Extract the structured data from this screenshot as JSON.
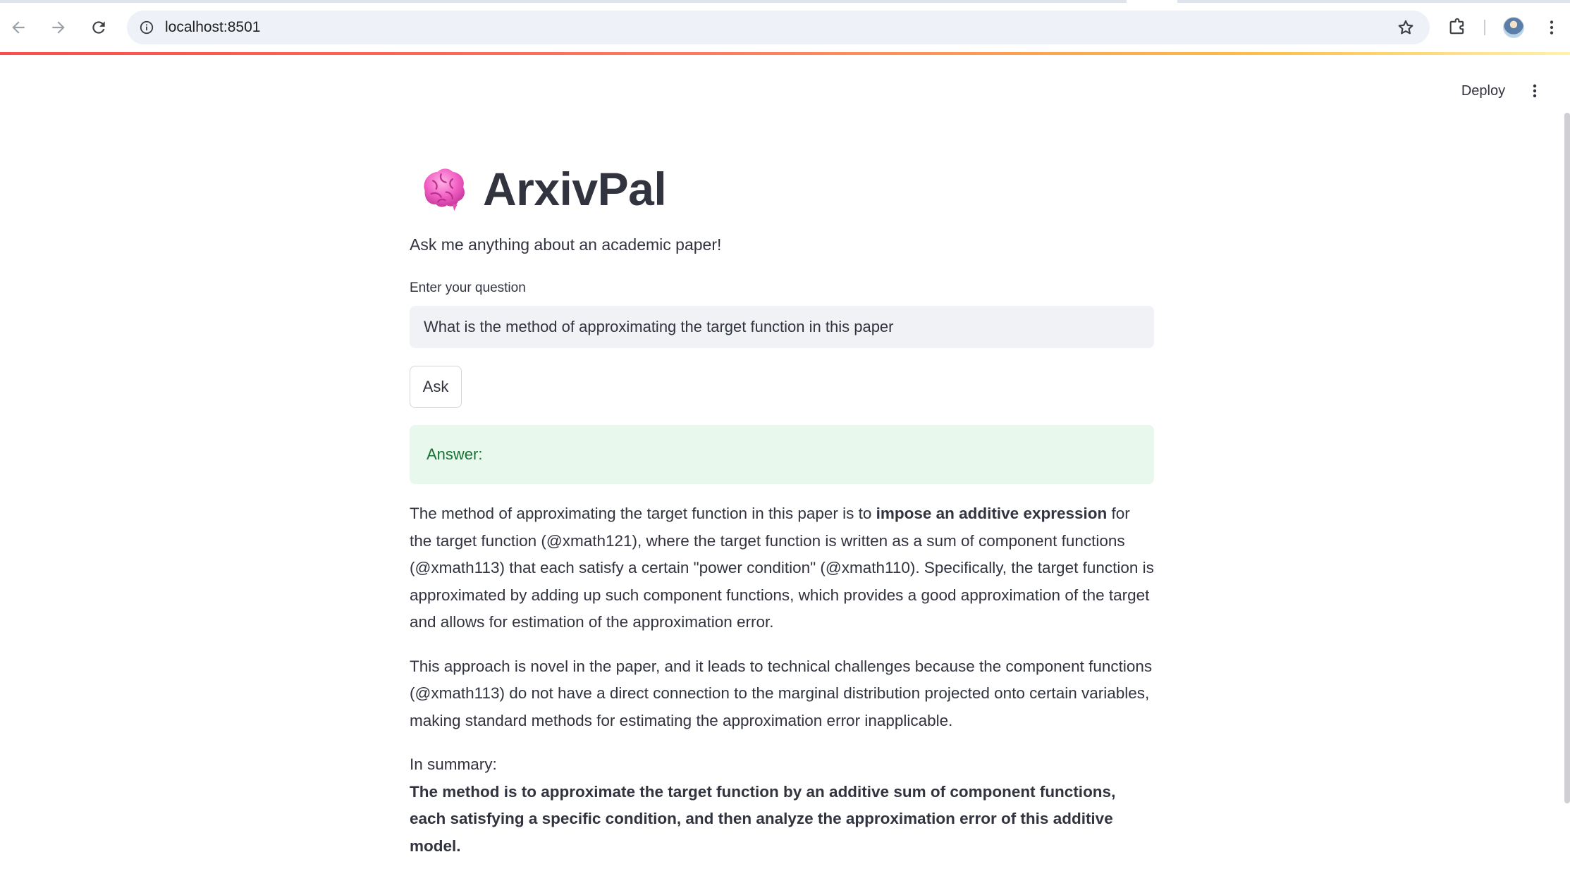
{
  "browser": {
    "url": "localhost:8501",
    "icons": [
      "back-arrow-icon",
      "forward-arrow-icon",
      "reload-icon",
      "site-info-icon",
      "bookmark-star-icon",
      "extensions-icon",
      "profile-avatar",
      "browser-menu-icon"
    ]
  },
  "header": {
    "deploy_label": "Deploy"
  },
  "app": {
    "title": "ArxivPal",
    "title_icon": "brain-emoji",
    "subtitle": "Ask me anything about an academic paper!",
    "input_label": "Enter your question",
    "input_value": "What is the method of approximating the target function in this paper",
    "ask_label": "Ask",
    "answer_label": "Answer:"
  },
  "answer": {
    "p1_a": "The method of approximating the target function in this paper is to ",
    "p1_bold": "impose an additive expression",
    "p1_b": " for the target function (@xmath121), where the target function is written as a sum of component functions (@xmath113) that each satisfy a certain \"power condition\" (@xmath110). Specifically, the target function is approximated by adding up such component functions, which provides a good approximation of the target and allows for estimation of the approximation error.",
    "p2": "This approach is novel in the paper, and it leads to technical challenges because the component functions (@xmath113) do not have a direct connection to the marginal distribution projected onto certain variables, making standard methods for estimating the approximation error inapplicable.",
    "summary_label": "In summary:",
    "summary_text": "The method is to approximate the target function by an additive sum of component functions, each satisfying a specific condition, and then analyze the approximation error of this additive model."
  },
  "colors": {
    "accent_bar": "#ff4b4b",
    "success_bg": "#e8f8ec",
    "success_text": "#177233",
    "text": "#31333f",
    "input_bg": "#f0f2f6"
  }
}
